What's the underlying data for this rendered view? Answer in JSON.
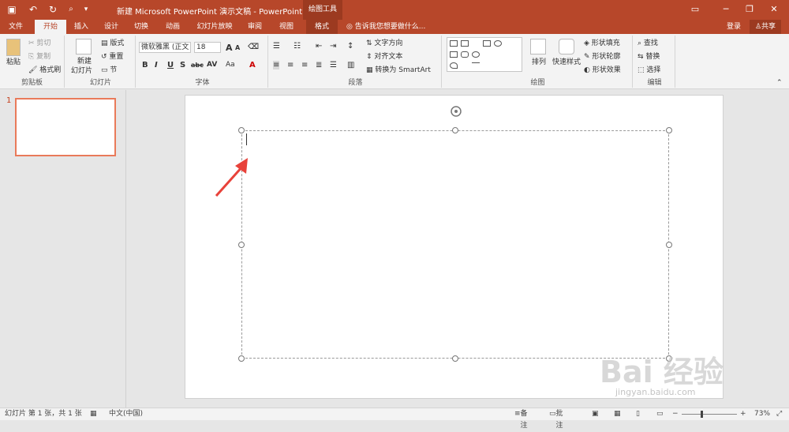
{
  "window": {
    "title": "新建 Microsoft PowerPoint 演示文稿 - PowerPoint",
    "context_tab": "绘图工具",
    "sign_in": "登录",
    "share": "共享"
  },
  "tabs": [
    "文件",
    "开始",
    "插入",
    "设计",
    "切换",
    "动画",
    "幻灯片放映",
    "审阅",
    "视图",
    "格式"
  ],
  "tellme": "告诉我您想要做什么...",
  "ribbon": {
    "clipboard": {
      "label": "剪贴板",
      "paste": "粘贴",
      "cut": "剪切",
      "copy": "复制",
      "painter": "格式刷"
    },
    "slides": {
      "label": "幻灯片",
      "new": "新建",
      "new2": "幻灯片",
      "layout": "版式",
      "reset": "重置",
      "section": "节"
    },
    "font": {
      "label": "字体",
      "name": "微软雅黑 (正文",
      "size": "18",
      "av": "AV",
      "aa": "Aa",
      "a_color": "A"
    },
    "paragraph": {
      "label": "段落",
      "dir": "文字方向",
      "align": "对齐文本",
      "smartart": "转换为 SmartArt"
    },
    "drawing": {
      "label": "绘图",
      "arrange": "排列",
      "quick": "快速样式",
      "fill": "形状填充",
      "outline": "形状轮廓",
      "effect": "形状效果"
    },
    "editing": {
      "label": "编辑",
      "find": "查找",
      "replace": "替换",
      "select": "选择"
    }
  },
  "slides_pane": {
    "number": "1"
  },
  "status": {
    "slide": "幻灯片 第 1 张，共 1 张",
    "lang": "中文(中国)",
    "notes": "备注",
    "comments": "批注",
    "zoom": "73%"
  },
  "watermark": {
    "brand": "Bai 经验",
    "url": "jingyan.baidu.com"
  },
  "colors": {
    "accent": "#b7472a",
    "thumb_border": "#e97a5a",
    "arrow": "#e8423a"
  }
}
